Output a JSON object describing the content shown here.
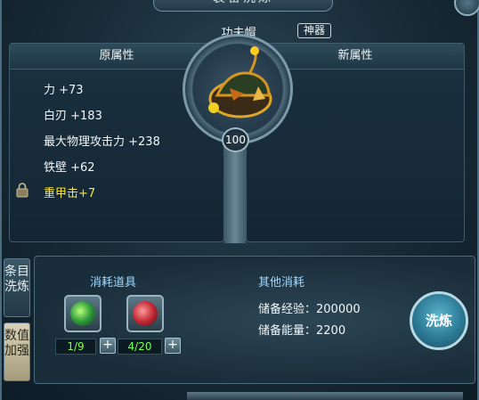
{
  "window": {
    "title": "装备洗炼"
  },
  "item": {
    "name": "功夫帽",
    "tag": "神器",
    "level": "100"
  },
  "panels": {
    "left_header": "原属性",
    "right_header": "新属性",
    "attributes": [
      {
        "text": "力 +73",
        "highlight": false
      },
      {
        "text": "白刃 +183",
        "highlight": false
      },
      {
        "text": "最大物理攻击力 +238",
        "highlight": false
      },
      {
        "text": "铁壁 +62",
        "highlight": false
      },
      {
        "text": "重甲击+7",
        "highlight": true,
        "locked": true
      }
    ]
  },
  "side_tabs": [
    {
      "label": "条目洗炼",
      "active": false
    },
    {
      "label": "数值加强",
      "active": true
    }
  ],
  "consume": {
    "title": "消耗道具",
    "items": [
      {
        "icon": "green-orb-icon",
        "count": "1/9"
      },
      {
        "icon": "red-orb-icon",
        "count": "4/20"
      }
    ],
    "plus": "+"
  },
  "other": {
    "title": "其他消耗",
    "exp": "储备经验：200000",
    "energy": "储备能量：2200"
  },
  "action": {
    "label": "洗炼"
  },
  "colors": {
    "highlight": "#ffe634",
    "count": "#7cff5a",
    "section_title": "#9fd8ff"
  }
}
